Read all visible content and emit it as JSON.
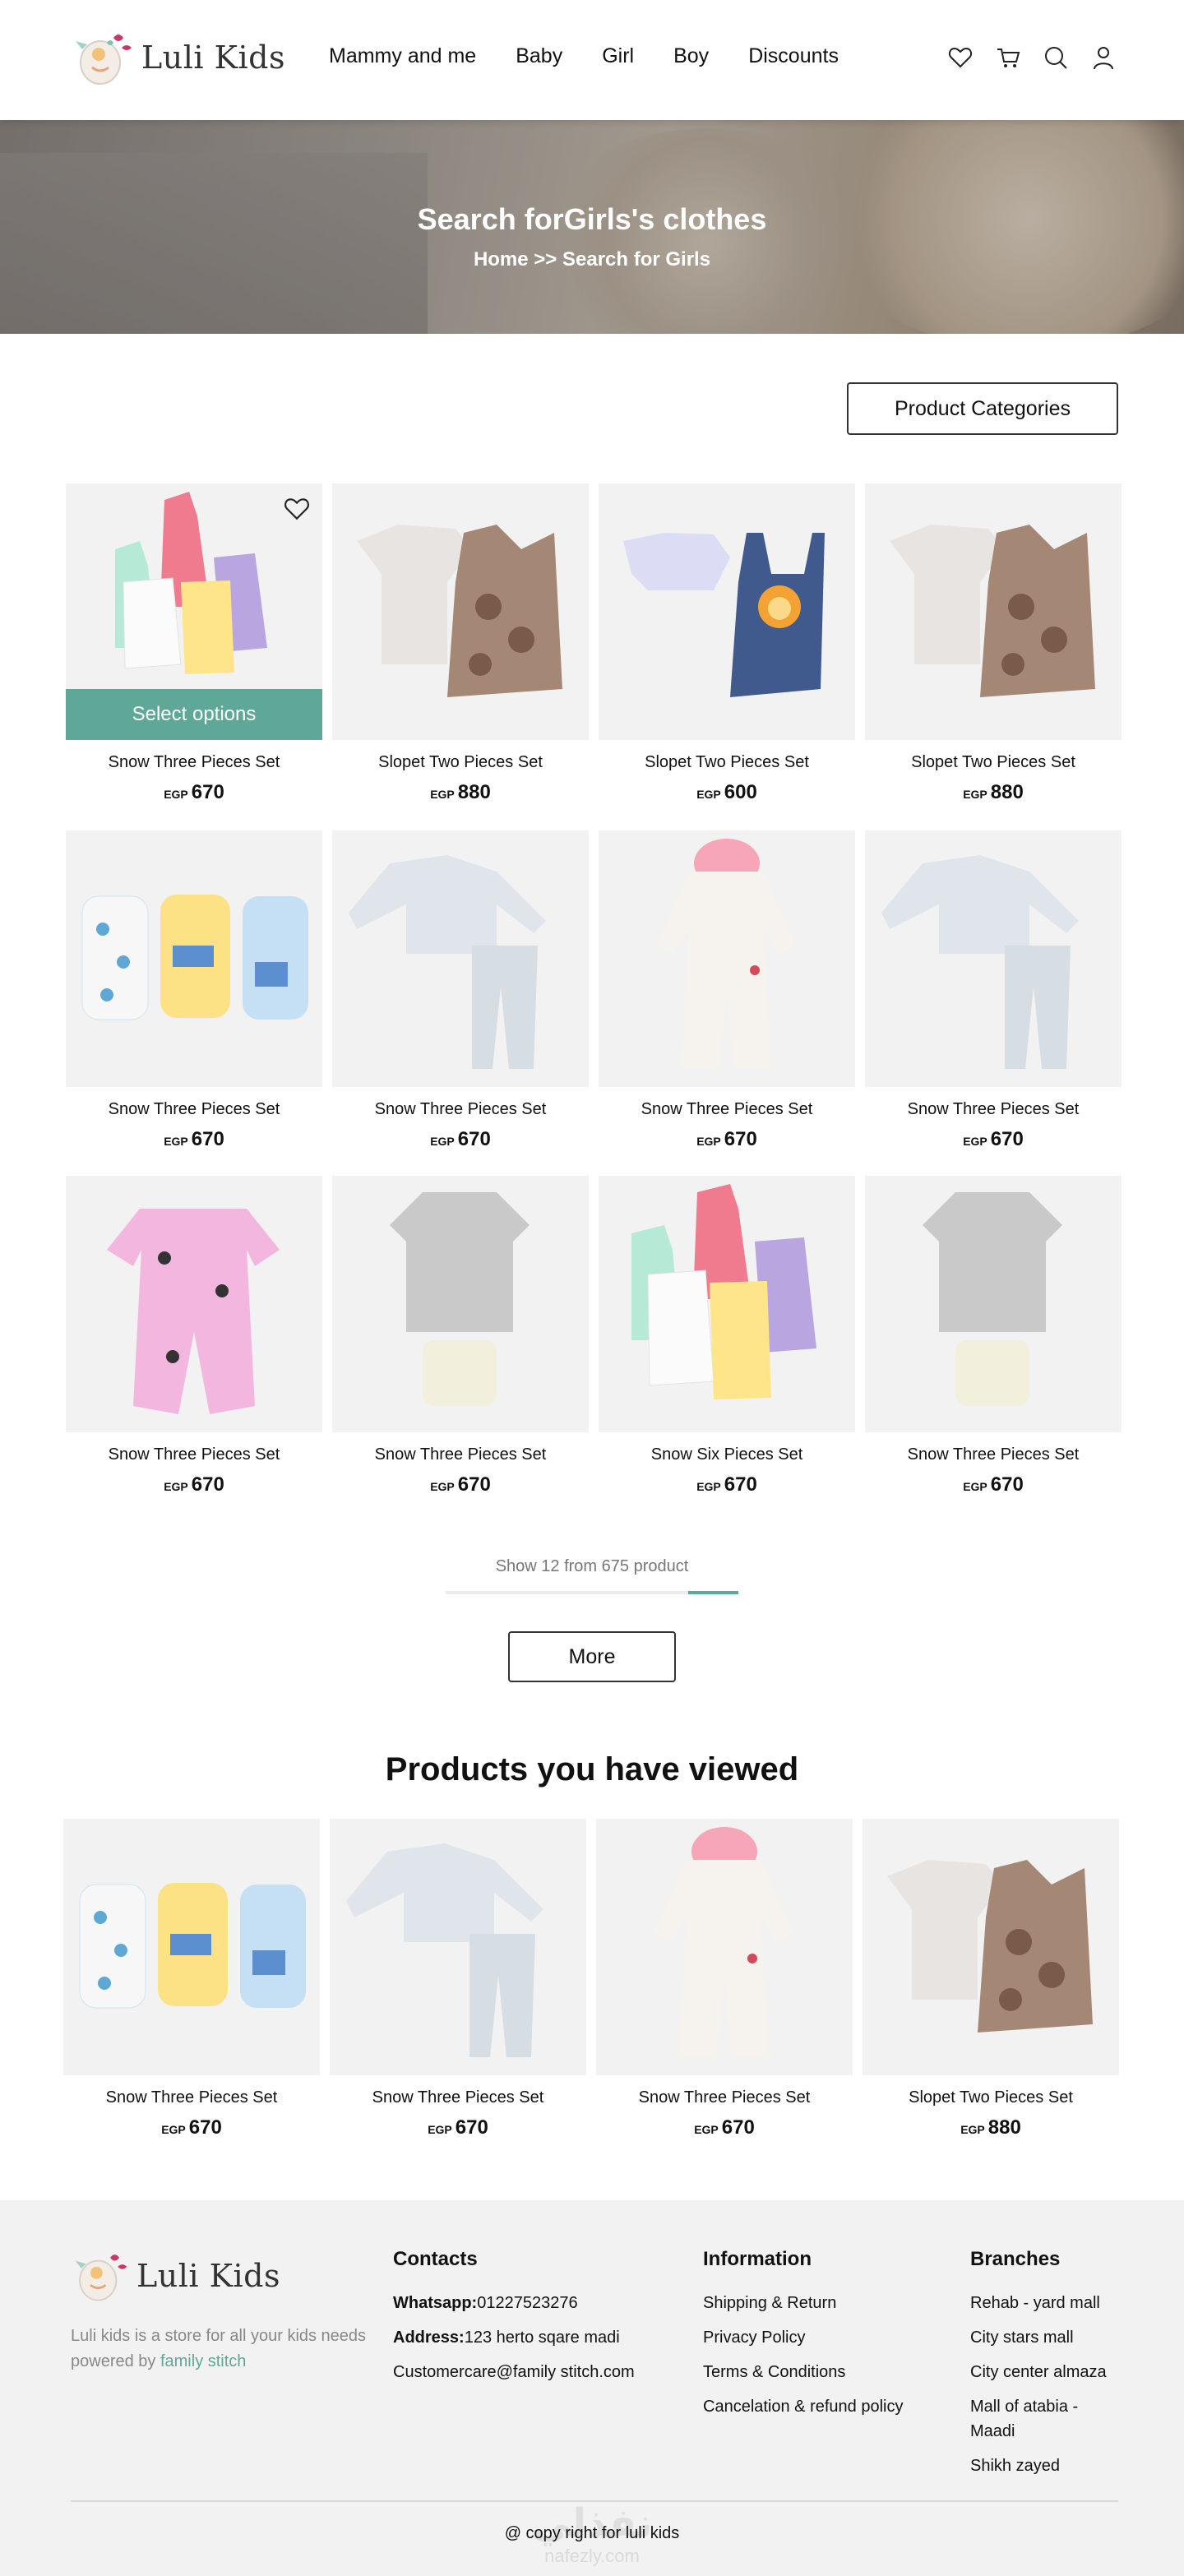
{
  "brand": {
    "name": "Luli Kids"
  },
  "nav": [
    "Mammy and me",
    "Baby",
    "Girl",
    "Boy",
    "Discounts"
  ],
  "header_icons": [
    "heart-icon",
    "cart-icon",
    "search-icon",
    "user-icon"
  ],
  "hero": {
    "title": "Search forGirls's clothes",
    "breadcrumb": "Home >> Search for Girls"
  },
  "categories_button": "Product Categories",
  "select_options_label": "Select options",
  "currency": "EGP",
  "colors": {
    "accent": "#5fa898",
    "card_bg": "#f2f2f2",
    "footer_bg": "#f2f2f2"
  },
  "products": [
    {
      "name": "Snow Three Pieces Set",
      "price": "670"
    },
    {
      "name": "Slopet Two Pieces Set",
      "price": "880"
    },
    {
      "name": "Slopet Two Pieces Set",
      "price": "600"
    },
    {
      "name": "Slopet Two Pieces Set",
      "price": "880"
    },
    {
      "name": "Snow Three Pieces Set",
      "price": "670"
    },
    {
      "name": "Snow Three Pieces Set",
      "price": "670"
    },
    {
      "name": "Snow Three Pieces Set",
      "price": "670"
    },
    {
      "name": "Snow Three Pieces Set",
      "price": "670"
    },
    {
      "name": "Snow Three Pieces Set",
      "price": "670"
    },
    {
      "name": "Snow Three Pieces Set",
      "price": "670"
    },
    {
      "name": "Snow Six Pieces Set",
      "price": "670"
    },
    {
      "name": "Snow Three Pieces Set",
      "price": "670"
    }
  ],
  "pagination": {
    "text": "Show 12 from 675 product",
    "progress": 0.17,
    "more_label": "More"
  },
  "viewed": {
    "title": "Products you have viewed",
    "items": [
      {
        "name": "Snow Three Pieces Set",
        "price": "670"
      },
      {
        "name": "Snow Three Pieces Set",
        "price": "670"
      },
      {
        "name": "Snow Three Pieces Set",
        "price": "670"
      },
      {
        "name": "Slopet Two Pieces Set",
        "price": "880"
      }
    ]
  },
  "footer": {
    "desc_pre": "Luli kids is a store for all your kids needs powered by ",
    "desc_link": "family stitch",
    "contacts": {
      "title": "Contacts",
      "whatsapp_label": "Whatsapp:",
      "whatsapp": "01227523276",
      "address_label": "Address:",
      "address": "123 herto sqare madi",
      "email": "Customercare@family stitch.com"
    },
    "information": {
      "title": "Information",
      "links": [
        "Shipping & Return",
        "Privacy Policy",
        "Terms & Conditions",
        "Cancelation & refund policy"
      ]
    },
    "branches": {
      "title": "Branches",
      "items": [
        "Rehab - yard mall",
        "City stars mall",
        "City center almaza",
        "Mall of atabia - Maadi",
        "Shikh zayed"
      ]
    },
    "copyright": "@ copy right for luli kids",
    "watermark": "نفذلي",
    "watermark_sub": "nafezly.com"
  }
}
